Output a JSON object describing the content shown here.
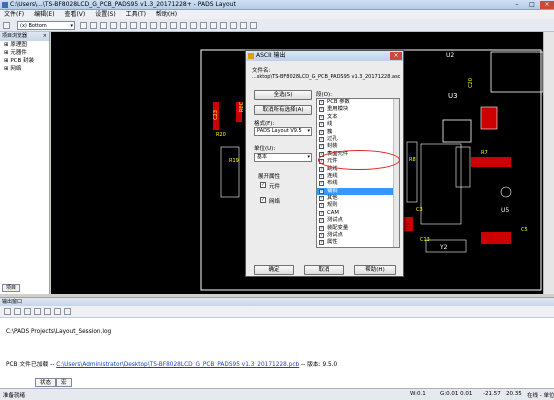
{
  "window": {
    "title": "C:\\Users\\...\\TS-BF8028LCD_G_PCB_PADS95 v1.3_20171228+ - PADS Layout"
  },
  "menu": [
    "文件(F)",
    "编辑(E)",
    "查看(V)",
    "设置(S)",
    "工具(T)",
    "帮助(H)"
  ],
  "toolbar": {
    "layer_select": "(x) Bottom"
  },
  "project_panel": {
    "title": "项目浏览器",
    "items": [
      "原理图",
      "元器件",
      "PCB 封装",
      "网络"
    ],
    "tab": "项目"
  },
  "pcb_labels": [
    "U2",
    "U3",
    "C20",
    "R8",
    "U5",
    "R20",
    "C23",
    "R19",
    "C13",
    "Y2",
    "C3",
    "R7",
    "C5",
    "REC"
  ],
  "dialog": {
    "title": "ASCII 输出",
    "file_name_label": "文件名:",
    "file_path": "...sktop\\TS-BF8028LCD_G_PCB_PADS95 v1.3_20171228.asc",
    "select_all_button": "全选(S)",
    "deselect_all_button": "取消所有选择(A)",
    "format_label": "格式(F):",
    "format_value": "PADS Layout V9.5",
    "units_label": "单位(U):",
    "units_value": "基本",
    "expand_attrs_label": "展开属性",
    "component_label": "元件",
    "network_label": "网络",
    "output_label": "段(O):",
    "items": [
      {
        "label": "PCB 参数",
        "checked": true
      },
      {
        "label": "重用模块",
        "checked": true
      },
      {
        "label": "文本",
        "checked": true
      },
      {
        "label": "线",
        "checked": true
      },
      {
        "label": "簇",
        "checked": true
      },
      {
        "label": "过孔",
        "checked": true
      },
      {
        "label": "封装",
        "checked": true
      },
      {
        "label": "表面元件",
        "checked": true
      },
      {
        "label": "元件",
        "checked": true
      },
      {
        "label": "跳线",
        "checked": true
      },
      {
        "label": "连线",
        "checked": true
      },
      {
        "label": "布线",
        "checked": true
      },
      {
        "label": "铺铜",
        "checked": true
      },
      {
        "label": "其他",
        "checked": true
      },
      {
        "label": "规则",
        "checked": true
      },
      {
        "label": "CAM",
        "checked": true
      },
      {
        "label": "测试点",
        "checked": true
      },
      {
        "label": "装配变量",
        "checked": true
      },
      {
        "label": "测试点",
        "checked": true
      },
      {
        "label": "属性",
        "checked": true
      }
    ],
    "selected_index": 12,
    "ok_button": "确定",
    "cancel_button": "取消",
    "help_button": "帮助(H)"
  },
  "output_panel": {
    "title": "输出窗口",
    "line1": "C:\\PADS Projects\\Layout_Session.log",
    "line2_prefix": "PCB 文件已加载 -- ",
    "line2_link": "C:\\Users\\Administrator\\Desktop\\TS-BF8028LCD_G_PCB_PADS95 v1.3_20171228.pcb",
    "line2_suffix": "-- 版本: 9.5.0",
    "tabs": [
      "状态",
      "宏"
    ]
  },
  "status_bar": {
    "ready": "准备就绪",
    "w": "W:0.1",
    "g": "G:0.01 0.01",
    "x": "-21.57",
    "y": "20.35",
    "layer": "在线 - 单位"
  },
  "colors": {
    "canvas_bg": "#000000",
    "board_outline": "#ffffff",
    "component_label": "#ffff00",
    "red_annotation": "#e3201b",
    "selection": "#3399ff"
  }
}
